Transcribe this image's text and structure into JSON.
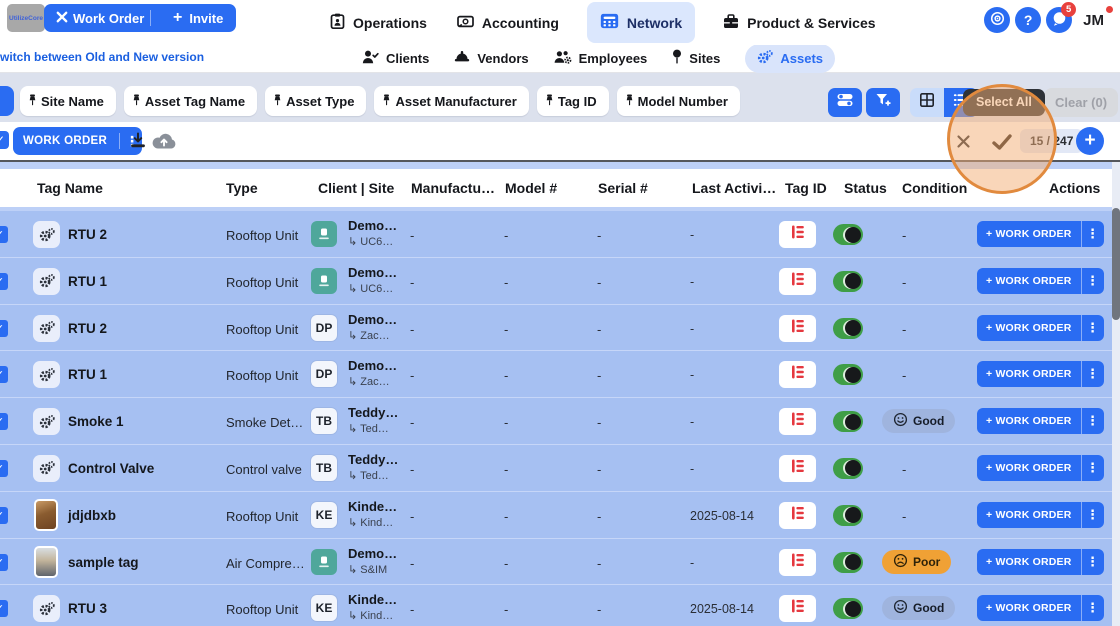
{
  "colors": {
    "accent_blue": "#2a6cf2",
    "row_blue": "#a6c0f2",
    "toggle_green": "#3f9e47",
    "tag_red": "#e5383f",
    "spotlight_orange": "#e18a3e",
    "poor_orange": "#f0a135",
    "good_badge": "#9fb4de"
  },
  "topbar": {
    "logo": "UtilizeCore",
    "work_order_button": "Work Order",
    "invite_button": "Invite",
    "nav": [
      {
        "label": "Operations"
      },
      {
        "label": "Accounting"
      },
      {
        "label": "Network",
        "active": true
      },
      {
        "label": "Product & Services"
      }
    ],
    "notifications_count": "5",
    "user_initials": "JM"
  },
  "subbar": {
    "version_link": "witch between Old and New version",
    "tabs": [
      {
        "label": "Clients"
      },
      {
        "label": "Vendors"
      },
      {
        "label": "Employees"
      },
      {
        "label": "Sites"
      },
      {
        "label": "Assets",
        "active": true
      }
    ]
  },
  "filterbar": {
    "chips": [
      "Site Name",
      "Asset Tag Name",
      "Asset Type",
      "Asset Manufacturer",
      "Tag ID",
      "Model Number"
    ],
    "select_all_tooltip": "Select All",
    "clear_button": "Clear (0)"
  },
  "actionbar": {
    "work_order_button": "WORK ORDER",
    "selection_count": "15 / 247"
  },
  "table": {
    "columns": [
      "Tag Name",
      "Type",
      "Client | Site",
      "Manufactu…",
      "Model #",
      "Serial #",
      "Last Activi…",
      "Tag ID",
      "Status",
      "Condition",
      "Actions"
    ],
    "row_action": "+ WORK ORDER",
    "rows": [
      {
        "tag_name": "RTU 2",
        "type": "Rooftop Unit",
        "leading": "gears",
        "avatar": "logo",
        "client": "Demo…",
        "site": "UC6…",
        "manufacturer": "-",
        "model": "-",
        "serial": "-",
        "last_activity": "-",
        "condition": "-"
      },
      {
        "tag_name": "RTU 1",
        "type": "Rooftop Unit",
        "leading": "gears",
        "avatar": "logo",
        "client": "Demo…",
        "site": "UC6…",
        "manufacturer": "-",
        "model": "-",
        "serial": "-",
        "last_activity": "-",
        "condition": "-"
      },
      {
        "tag_name": "RTU 2",
        "type": "Rooftop Unit",
        "leading": "gears",
        "avatar": "DP",
        "client": "Demo…",
        "site": "Zac…",
        "manufacturer": "-",
        "model": "-",
        "serial": "-",
        "last_activity": "-",
        "condition": "-"
      },
      {
        "tag_name": "RTU 1",
        "type": "Rooftop Unit",
        "leading": "gears",
        "avatar": "DP",
        "client": "Demo…",
        "site": "Zac…",
        "manufacturer": "-",
        "model": "-",
        "serial": "-",
        "last_activity": "-",
        "condition": "-"
      },
      {
        "tag_name": "Smoke 1",
        "type": "Smoke Det…",
        "leading": "gears",
        "avatar": "TB",
        "client": "Teddy…",
        "site": "Ted…",
        "manufacturer": "-",
        "model": "-",
        "serial": "-",
        "last_activity": "-",
        "condition": "Good"
      },
      {
        "tag_name": "Control Valve",
        "type": "Control valve",
        "leading": "gears",
        "avatar": "TB",
        "client": "Teddy…",
        "site": "Ted…",
        "manufacturer": "-",
        "model": "-",
        "serial": "-",
        "last_activity": "-",
        "condition": "-"
      },
      {
        "tag_name": "jdjdbxb",
        "type": "Rooftop Unit",
        "leading": "photo-wood",
        "avatar": "KE",
        "client": "Kinde…",
        "site": "Kind…",
        "manufacturer": "-",
        "model": "-",
        "serial": "-",
        "last_activity": "2025-08-14",
        "condition": "-"
      },
      {
        "tag_name": "sample tag",
        "type": "Air Compre…",
        "leading": "photo-desk",
        "avatar": "logo",
        "client": "Demo…",
        "site": "S&IM",
        "manufacturer": "-",
        "model": "-",
        "serial": "-",
        "last_activity": "-",
        "condition": "Poor"
      },
      {
        "tag_name": "RTU 3",
        "type": "Rooftop Unit",
        "leading": "gears",
        "avatar": "KE",
        "client": "Kinde…",
        "site": "Kind…",
        "manufacturer": "-",
        "model": "-",
        "serial": "-",
        "last_activity": "2025-08-14",
        "condition": "Good"
      }
    ]
  }
}
